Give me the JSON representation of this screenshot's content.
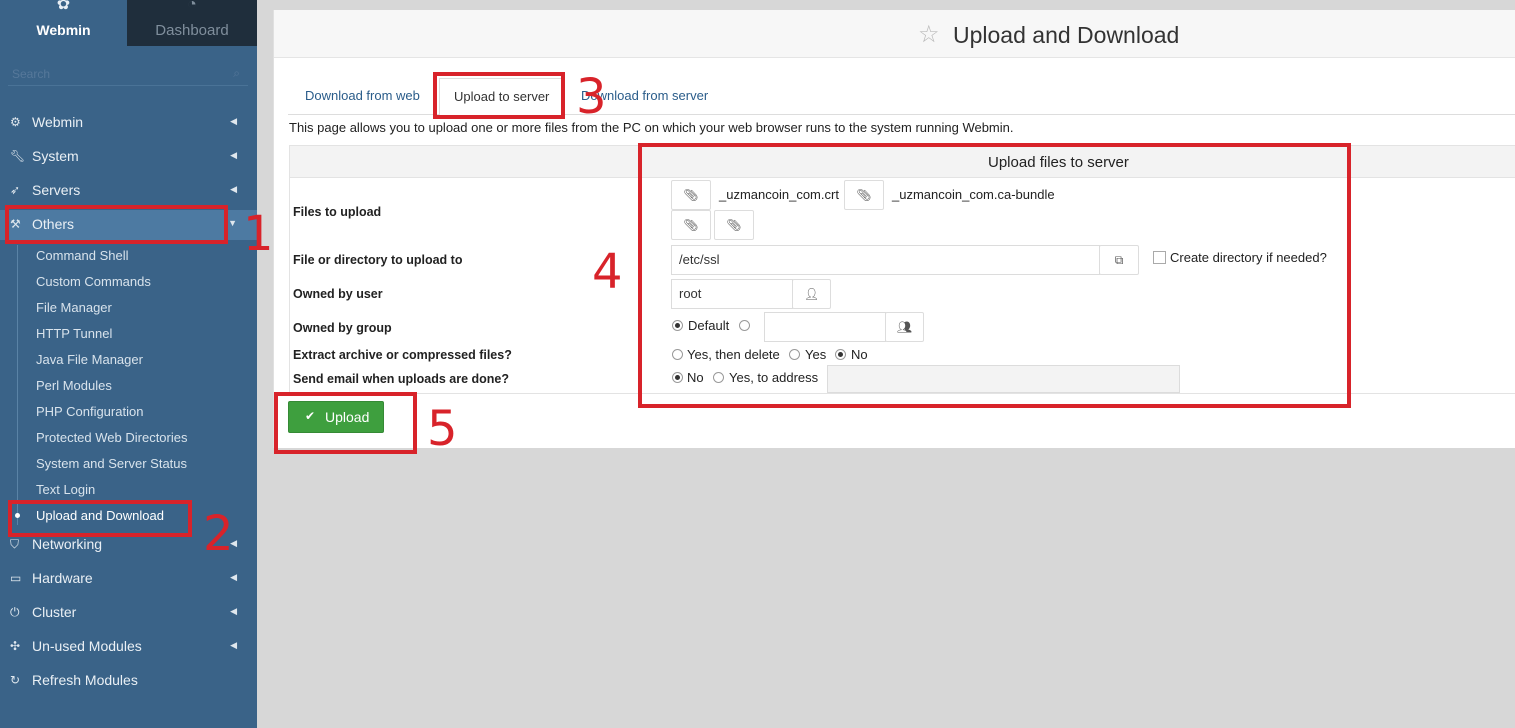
{
  "sidebar": {
    "top": {
      "webmin_label": "Webmin",
      "dashboard_label": "Dashboard"
    },
    "search_placeholder": "Search",
    "items": [
      {
        "label": "Webmin",
        "icon": "gear-icon"
      },
      {
        "label": "System",
        "icon": "wrench-icon"
      },
      {
        "label": "Servers",
        "icon": "rocket-icon"
      },
      {
        "label": "Others",
        "icon": "tools-icon"
      },
      {
        "label": "Networking",
        "icon": "shield-icon"
      },
      {
        "label": "Hardware",
        "icon": "drive-icon"
      },
      {
        "label": "Cluster",
        "icon": "power-icon"
      },
      {
        "label": "Un-used Modules",
        "icon": "puzzle-icon"
      },
      {
        "label": "Refresh Modules",
        "icon": "refresh-icon"
      }
    ],
    "sub_items": [
      "Command Shell",
      "Custom Commands",
      "File Manager",
      "HTTP Tunnel",
      "Java File Manager",
      "Perl Modules",
      "PHP Configuration",
      "Protected Web Directories",
      "System and Server Status",
      "Text Login",
      "Upload and Download"
    ]
  },
  "main": {
    "title": "Upload and Download",
    "tabs": [
      "Download from web",
      "Upload to server",
      "Download from server"
    ],
    "description": "This page allows you to upload one or more files from the PC on which your web browser runs to the system running Webmin.",
    "form": {
      "header": "Upload files to server",
      "labels": {
        "files": "Files to upload",
        "dest": "File or directory to upload to",
        "user": "Owned by user",
        "group": "Owned by group",
        "extract": "Extract archive or compressed files?",
        "email": "Send email when uploads are done?"
      },
      "file1": "_uzmancoin_com.crt",
      "file2": "_uzmancoin_com.ca-bundle",
      "dest_value": "/etc/ssl",
      "create_dir": "Create directory if needed?",
      "user_value": "root",
      "group_default": "Default",
      "extract_options": [
        "Yes, then delete",
        "Yes",
        "No"
      ],
      "email_options": [
        "No",
        "Yes, to address"
      ]
    },
    "upload_button": "Upload"
  },
  "annotations": [
    "1",
    "2",
    "3",
    "4",
    "5"
  ],
  "colors": {
    "sidebar": "#3a6388",
    "annotation": "#d8232a",
    "upload": "#3e9f3e"
  }
}
